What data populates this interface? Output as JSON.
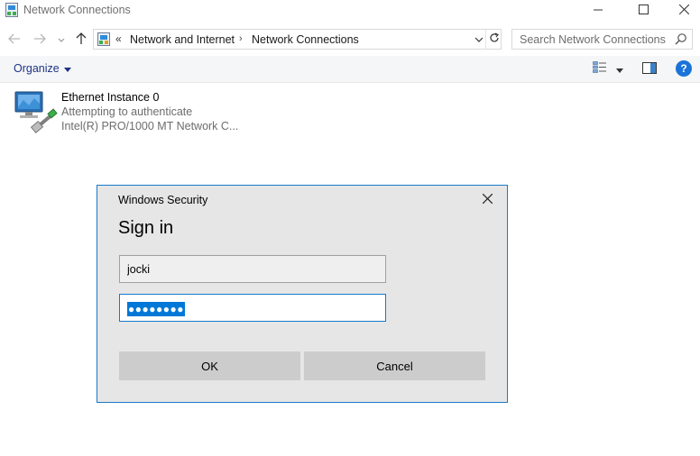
{
  "window": {
    "title": "Network Connections",
    "icons": {
      "app": "network-connections-icon",
      "minimize": "minimize-icon",
      "maximize": "maximize-icon",
      "close": "close-icon"
    }
  },
  "navigation": {
    "icons": {
      "back": "back-arrow-icon",
      "forward": "forward-arrow-icon",
      "recent": "chevron-down-icon",
      "up": "up-arrow-icon",
      "refresh": "refresh-icon"
    },
    "address": {
      "overflow": "«",
      "breadcrumbs": [
        "Network and Internet",
        "Network Connections"
      ],
      "separator": "›"
    },
    "search": {
      "placeholder": "Search Network Connections"
    }
  },
  "command_bar": {
    "organize_label": "Organize",
    "icons": {
      "view": "details-view-icon",
      "preview_pane": "preview-pane-icon",
      "help": "help-icon"
    },
    "help_glyph": "?"
  },
  "items": [
    {
      "name": "Ethernet Instance 0",
      "status": "Attempting to authenticate",
      "device": "Intel(R) PRO/1000 MT Network C..."
    }
  ],
  "dialog": {
    "title": "Windows Security",
    "heading": "Sign in",
    "username": "jocki",
    "password_mask": "●●●●●●●●",
    "ok_label": "OK",
    "cancel_label": "Cancel"
  },
  "colors": {
    "accent": "#1979ca",
    "selection": "#0078d7",
    "dialog_bg": "#e6e6e6",
    "button_bg": "#cccccc",
    "link": "#1e3287"
  }
}
